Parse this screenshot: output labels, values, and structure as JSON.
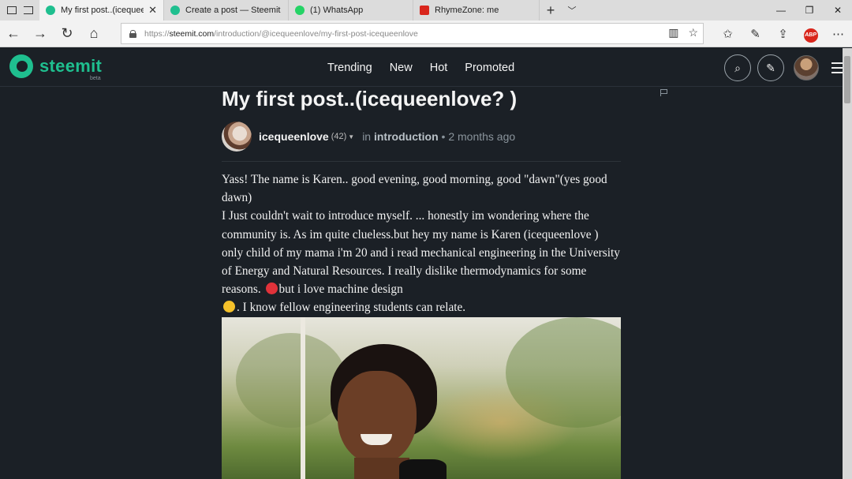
{
  "browser": {
    "tabs": [
      {
        "title": "My first post..(icequeenl",
        "favicon_color": "#1fbf8f",
        "active": true
      },
      {
        "title": "Create a post — Steemit",
        "favicon_color": "#1fbf8f",
        "active": false
      },
      {
        "title": "(1) WhatsApp",
        "favicon_color": "#25d366",
        "active": false
      },
      {
        "title": "RhymeZone: me",
        "favicon_color": "#d9261c",
        "active": false
      }
    ],
    "url_prefix": "https://",
    "url_domain": "steemit.com",
    "url_path": "/introduction/@icequeenlove/my-first-post-icequeenlove",
    "abp_label": "ABP"
  },
  "site": {
    "logo_text": "steemit",
    "beta_label": "beta",
    "accent": "#1fbf8f",
    "nav": [
      "Trending",
      "New",
      "Hot",
      "Promoted"
    ]
  },
  "post": {
    "title": "My first post..(icequeenlove? )",
    "author": "icequeenlove",
    "reputation": "(42)",
    "in_label": "in",
    "category": "introduction",
    "separator": "•",
    "time": "2 months ago",
    "paragraphs": [
      "Yass! The name is Karen.. good evening, good morning, good \"dawn\"(yes good dawn)",
      "I Just couldn't wait to introduce myself. ... honestly im wondering where the community is. As im quite clueless.but hey my name is Karen (icequeenlove ) only child of my mama i'm 20 and i read mechanical engineering in the University of Energy and Natural Resources. I really dislike thermodynamics for some reasons.",
      "but i love machine design",
      ". I know fellow engineering students can relate."
    ]
  }
}
